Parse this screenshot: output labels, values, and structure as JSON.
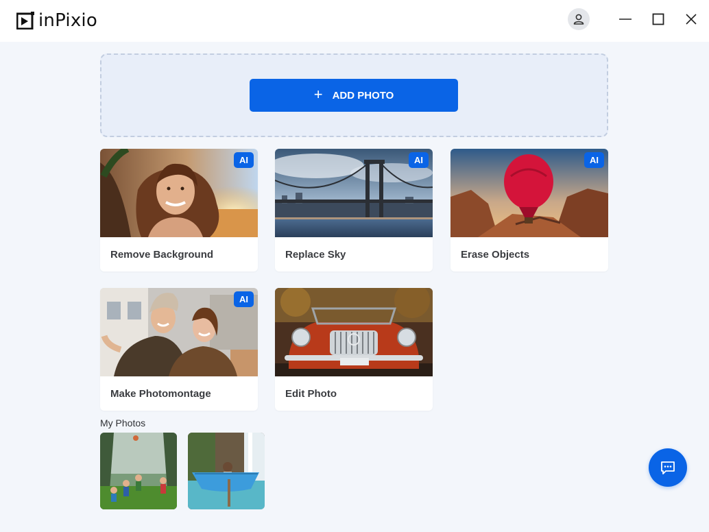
{
  "app": {
    "name": "inPixio",
    "brand_color": "#0a64e6"
  },
  "titlebar": {
    "account_icon": "user-icon",
    "minimize_icon": "minimize-icon",
    "maximize_icon": "maximize-icon",
    "close_icon": "close-icon"
  },
  "dropzone": {
    "button_label": "ADD PHOTO",
    "button_icon": "plus-icon"
  },
  "tools": [
    {
      "label": "Remove Background",
      "ai": true,
      "badge": "AI"
    },
    {
      "label": "Replace Sky",
      "ai": true,
      "badge": "AI"
    },
    {
      "label": "Erase Objects",
      "ai": true,
      "badge": "AI"
    },
    {
      "label": "Make Photomontage",
      "ai": true,
      "badge": "AI"
    },
    {
      "label": "Edit Photo",
      "ai": false
    }
  ],
  "my_photos": {
    "title": "My Photos",
    "items": [
      {
        "name": "park-photo"
      },
      {
        "name": "waterfall-photo"
      }
    ]
  },
  "chat": {
    "icon": "chat-icon"
  }
}
